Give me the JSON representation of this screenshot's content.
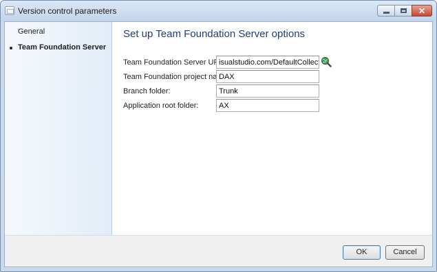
{
  "window": {
    "title": "Version control parameters"
  },
  "nav": {
    "items": [
      {
        "label": "General",
        "selected": false
      },
      {
        "label": "Team Foundation Server",
        "selected": true
      }
    ]
  },
  "content": {
    "heading": "Set up Team Foundation Server options",
    "fields": [
      {
        "label": "Team Foundation Server URL:",
        "value": "isualstudio.com/DefaultCollection"
      },
      {
        "label": "Team Foundation project name:",
        "value": "DAX"
      },
      {
        "label": "Branch folder:",
        "value": "Trunk"
      },
      {
        "label": "Application root folder:",
        "value": "AX"
      }
    ],
    "lookup_icon": "search-globe-icon"
  },
  "footer": {
    "ok_label": "OK",
    "cancel_label": "Cancel"
  },
  "colors": {
    "heading": "#1f3d7a",
    "frame": "#c9daed",
    "nav_background": "#e2ecf7"
  }
}
